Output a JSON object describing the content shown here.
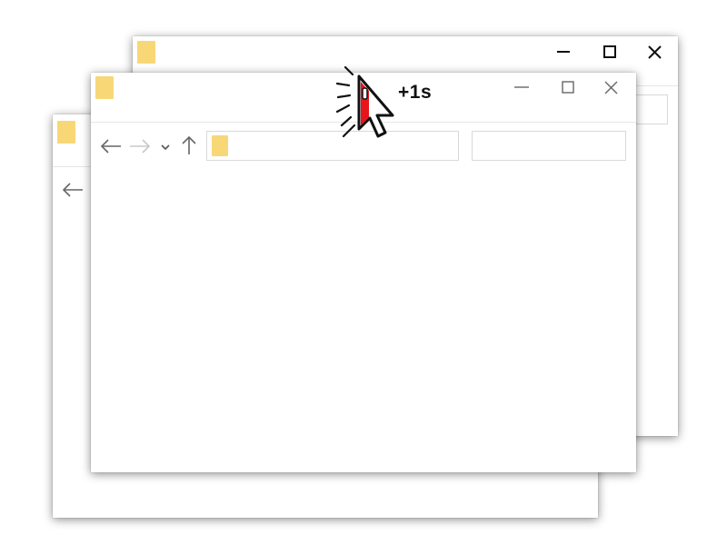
{
  "overlay": {
    "time_bonus": "+1s"
  },
  "icons": {
    "folder": "folder-icon",
    "minimize": "minimize-icon",
    "maximize": "maximize-icon",
    "close": "close-icon",
    "back": "arrow-left-icon",
    "forward": "arrow-right-icon",
    "recent": "chevron-down-icon",
    "up": "arrow-up-icon",
    "cursor": "mouse-pointer-icon"
  },
  "colors": {
    "folder": "#f8d777",
    "cursor_fill": "#e8141b",
    "window_bg": "#ffffff",
    "border": "#d9d9d9"
  },
  "windows": [
    {
      "id": "back-right-window",
      "state": "inactive"
    },
    {
      "id": "back-left-window",
      "state": "inactive"
    },
    {
      "id": "front-window",
      "state": "active"
    }
  ]
}
